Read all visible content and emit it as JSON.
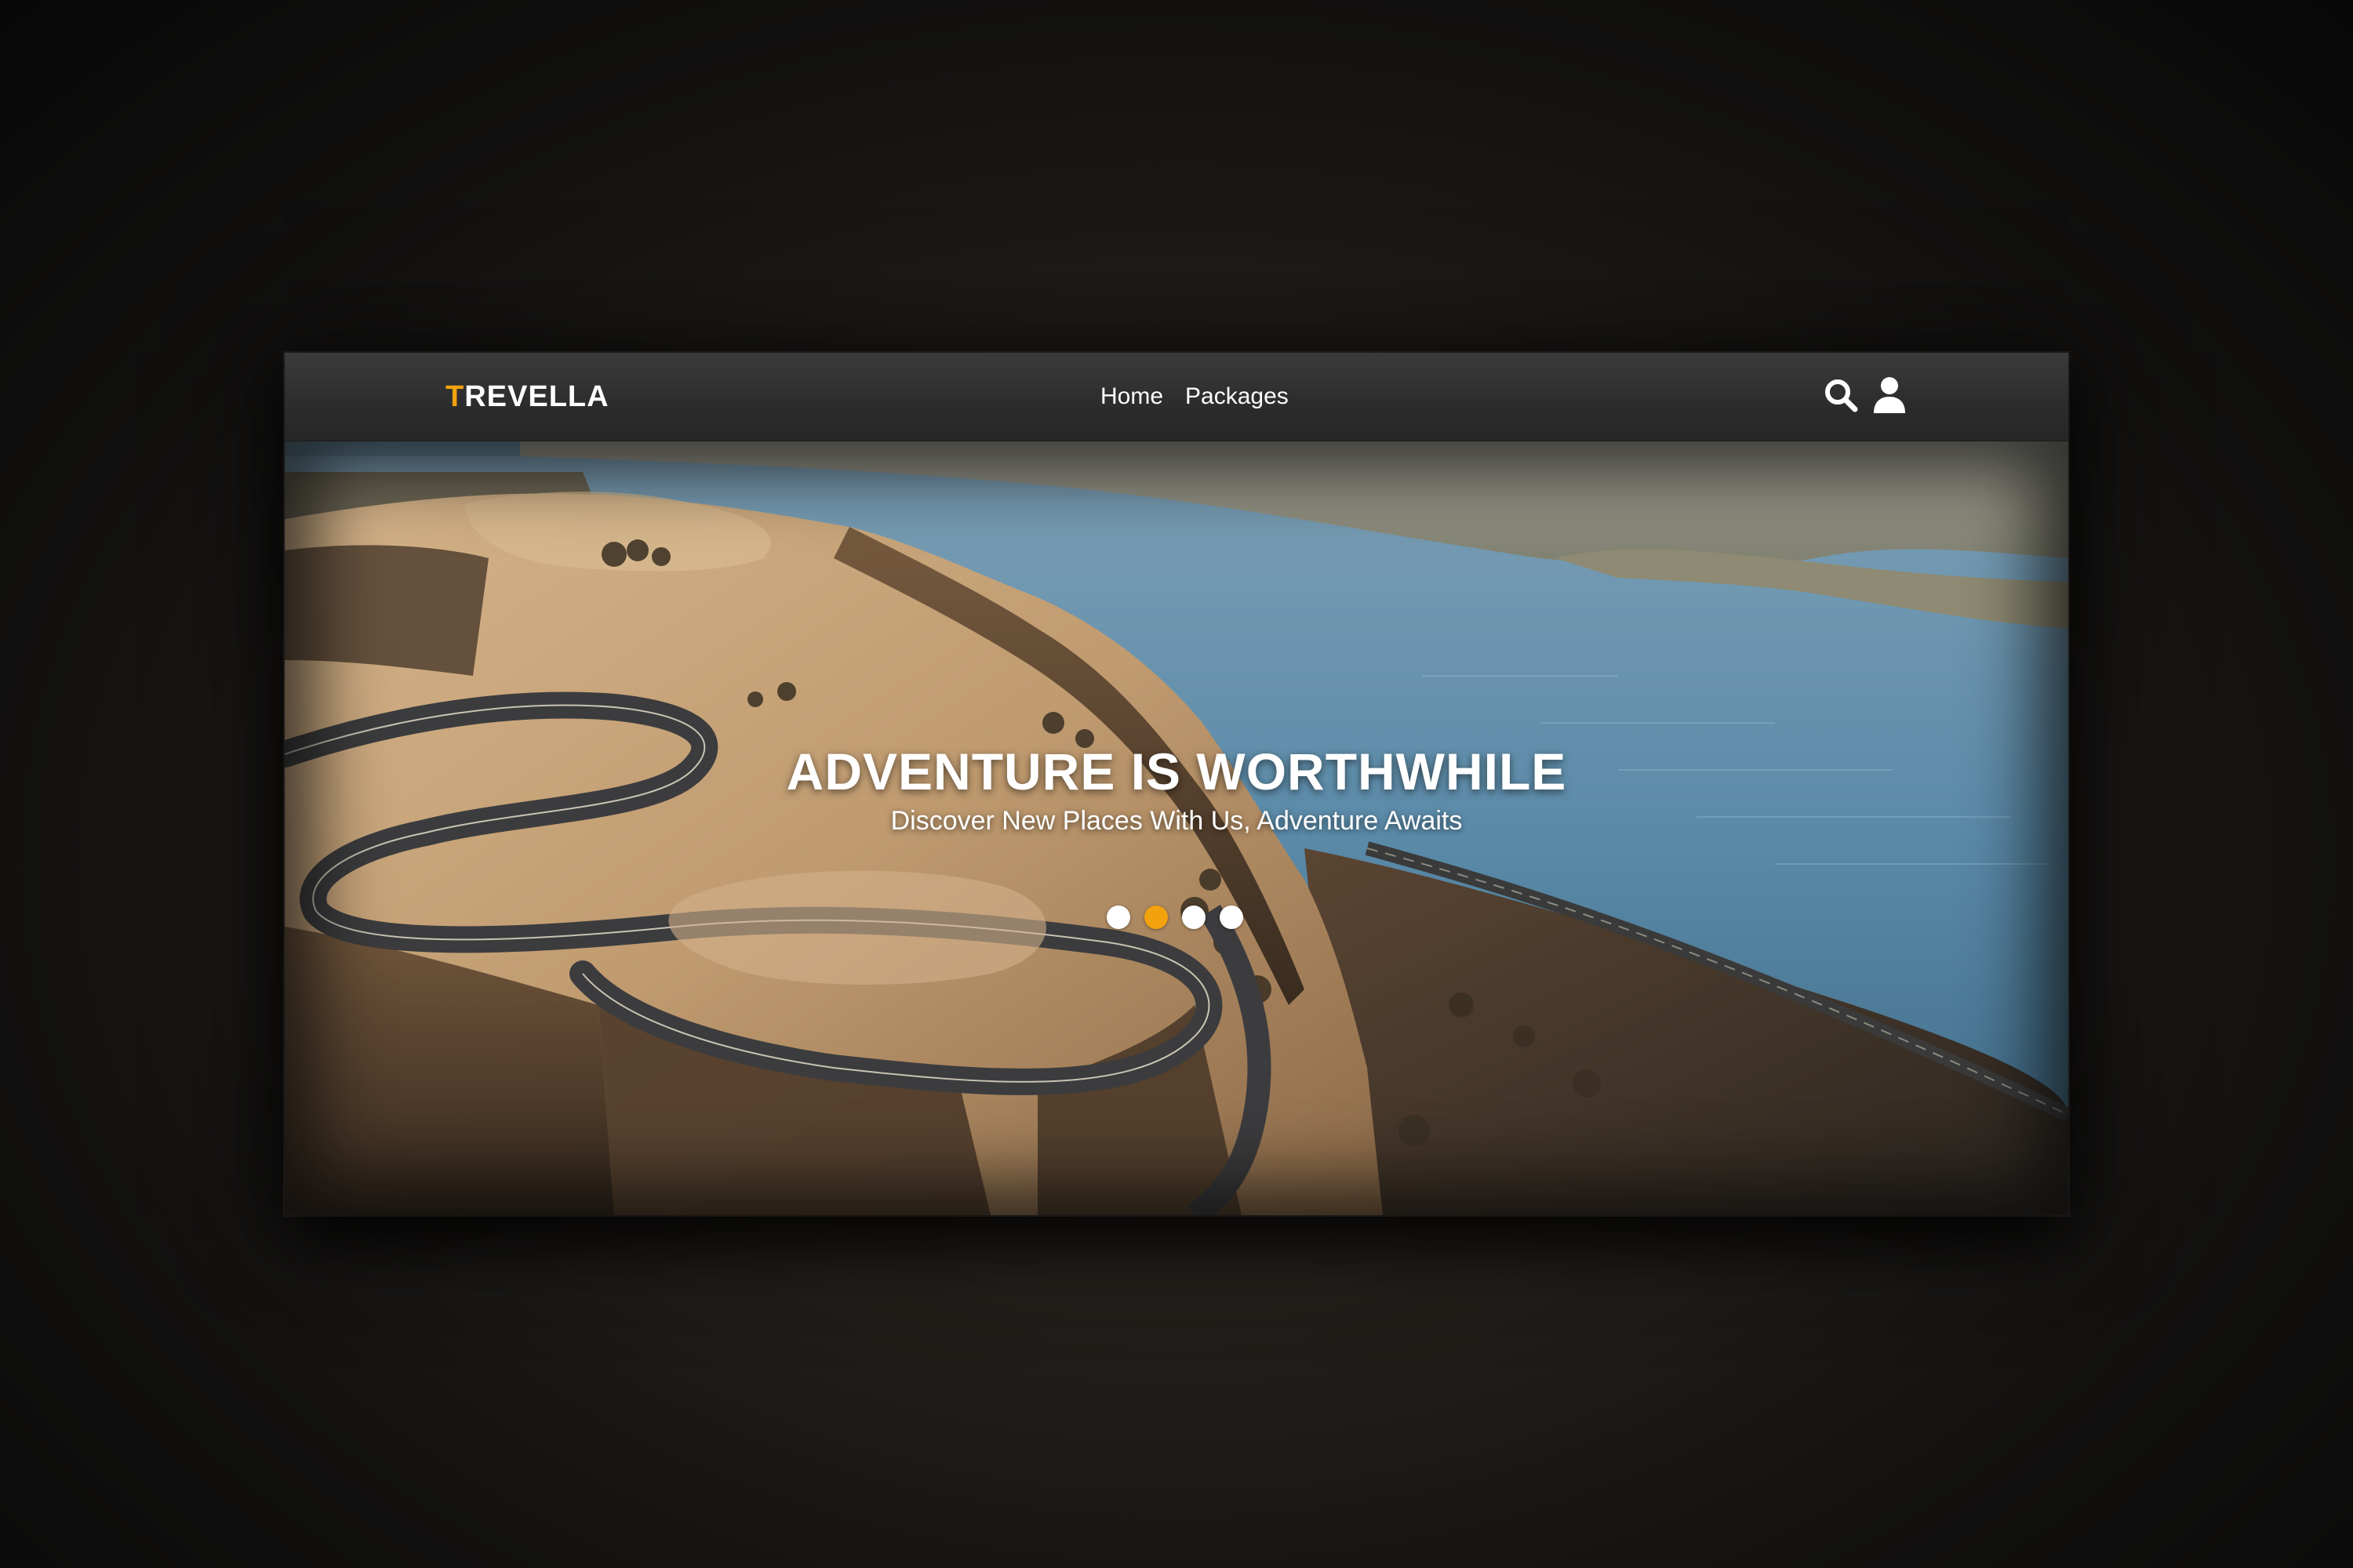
{
  "brand": {
    "first_letter": "T",
    "rest": "REVELLA",
    "accent_color": "#f2a20c"
  },
  "nav": {
    "links": [
      {
        "label": "Home"
      },
      {
        "label": "Packages"
      }
    ],
    "icons": [
      "search-icon",
      "user-icon"
    ]
  },
  "hero": {
    "title": "ADVENTURE IS WORTHWHILE",
    "subtitle": "Discover New Places With Us, Adventure Awaits",
    "slides_count": 4,
    "active_slide": 2
  },
  "colors": {
    "navbar": "#2c2c2c",
    "accent": "#f2a20c",
    "water": "#5f8aa6",
    "land": "#c9a57c"
  }
}
